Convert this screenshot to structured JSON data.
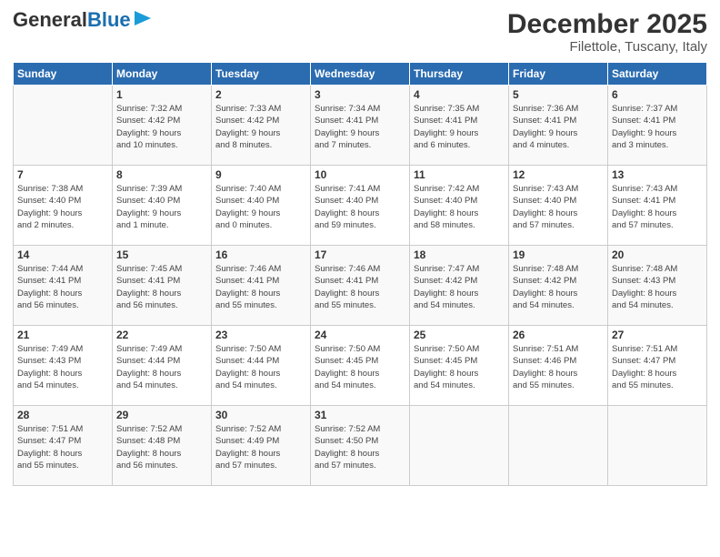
{
  "header": {
    "logo_general": "General",
    "logo_blue": "Blue",
    "title": "December 2025",
    "subtitle": "Filettole, Tuscany, Italy"
  },
  "days_of_week": [
    "Sunday",
    "Monday",
    "Tuesday",
    "Wednesday",
    "Thursday",
    "Friday",
    "Saturday"
  ],
  "weeks": [
    [
      {
        "day": "",
        "info": ""
      },
      {
        "day": "1",
        "info": "Sunrise: 7:32 AM\nSunset: 4:42 PM\nDaylight: 9 hours\nand 10 minutes."
      },
      {
        "day": "2",
        "info": "Sunrise: 7:33 AM\nSunset: 4:42 PM\nDaylight: 9 hours\nand 8 minutes."
      },
      {
        "day": "3",
        "info": "Sunrise: 7:34 AM\nSunset: 4:41 PM\nDaylight: 9 hours\nand 7 minutes."
      },
      {
        "day": "4",
        "info": "Sunrise: 7:35 AM\nSunset: 4:41 PM\nDaylight: 9 hours\nand 6 minutes."
      },
      {
        "day": "5",
        "info": "Sunrise: 7:36 AM\nSunset: 4:41 PM\nDaylight: 9 hours\nand 4 minutes."
      },
      {
        "day": "6",
        "info": "Sunrise: 7:37 AM\nSunset: 4:41 PM\nDaylight: 9 hours\nand 3 minutes."
      }
    ],
    [
      {
        "day": "7",
        "info": "Sunrise: 7:38 AM\nSunset: 4:40 PM\nDaylight: 9 hours\nand 2 minutes."
      },
      {
        "day": "8",
        "info": "Sunrise: 7:39 AM\nSunset: 4:40 PM\nDaylight: 9 hours\nand 1 minute."
      },
      {
        "day": "9",
        "info": "Sunrise: 7:40 AM\nSunset: 4:40 PM\nDaylight: 9 hours\nand 0 minutes."
      },
      {
        "day": "10",
        "info": "Sunrise: 7:41 AM\nSunset: 4:40 PM\nDaylight: 8 hours\nand 59 minutes."
      },
      {
        "day": "11",
        "info": "Sunrise: 7:42 AM\nSunset: 4:40 PM\nDaylight: 8 hours\nand 58 minutes."
      },
      {
        "day": "12",
        "info": "Sunrise: 7:43 AM\nSunset: 4:40 PM\nDaylight: 8 hours\nand 57 minutes."
      },
      {
        "day": "13",
        "info": "Sunrise: 7:43 AM\nSunset: 4:41 PM\nDaylight: 8 hours\nand 57 minutes."
      }
    ],
    [
      {
        "day": "14",
        "info": "Sunrise: 7:44 AM\nSunset: 4:41 PM\nDaylight: 8 hours\nand 56 minutes."
      },
      {
        "day": "15",
        "info": "Sunrise: 7:45 AM\nSunset: 4:41 PM\nDaylight: 8 hours\nand 56 minutes."
      },
      {
        "day": "16",
        "info": "Sunrise: 7:46 AM\nSunset: 4:41 PM\nDaylight: 8 hours\nand 55 minutes."
      },
      {
        "day": "17",
        "info": "Sunrise: 7:46 AM\nSunset: 4:41 PM\nDaylight: 8 hours\nand 55 minutes."
      },
      {
        "day": "18",
        "info": "Sunrise: 7:47 AM\nSunset: 4:42 PM\nDaylight: 8 hours\nand 54 minutes."
      },
      {
        "day": "19",
        "info": "Sunrise: 7:48 AM\nSunset: 4:42 PM\nDaylight: 8 hours\nand 54 minutes."
      },
      {
        "day": "20",
        "info": "Sunrise: 7:48 AM\nSunset: 4:43 PM\nDaylight: 8 hours\nand 54 minutes."
      }
    ],
    [
      {
        "day": "21",
        "info": "Sunrise: 7:49 AM\nSunset: 4:43 PM\nDaylight: 8 hours\nand 54 minutes."
      },
      {
        "day": "22",
        "info": "Sunrise: 7:49 AM\nSunset: 4:44 PM\nDaylight: 8 hours\nand 54 minutes."
      },
      {
        "day": "23",
        "info": "Sunrise: 7:50 AM\nSunset: 4:44 PM\nDaylight: 8 hours\nand 54 minutes."
      },
      {
        "day": "24",
        "info": "Sunrise: 7:50 AM\nSunset: 4:45 PM\nDaylight: 8 hours\nand 54 minutes."
      },
      {
        "day": "25",
        "info": "Sunrise: 7:50 AM\nSunset: 4:45 PM\nDaylight: 8 hours\nand 54 minutes."
      },
      {
        "day": "26",
        "info": "Sunrise: 7:51 AM\nSunset: 4:46 PM\nDaylight: 8 hours\nand 55 minutes."
      },
      {
        "day": "27",
        "info": "Sunrise: 7:51 AM\nSunset: 4:47 PM\nDaylight: 8 hours\nand 55 minutes."
      }
    ],
    [
      {
        "day": "28",
        "info": "Sunrise: 7:51 AM\nSunset: 4:47 PM\nDaylight: 8 hours\nand 55 minutes."
      },
      {
        "day": "29",
        "info": "Sunrise: 7:52 AM\nSunset: 4:48 PM\nDaylight: 8 hours\nand 56 minutes."
      },
      {
        "day": "30",
        "info": "Sunrise: 7:52 AM\nSunset: 4:49 PM\nDaylight: 8 hours\nand 57 minutes."
      },
      {
        "day": "31",
        "info": "Sunrise: 7:52 AM\nSunset: 4:50 PM\nDaylight: 8 hours\nand 57 minutes."
      },
      {
        "day": "",
        "info": ""
      },
      {
        "day": "",
        "info": ""
      },
      {
        "day": "",
        "info": ""
      }
    ]
  ]
}
